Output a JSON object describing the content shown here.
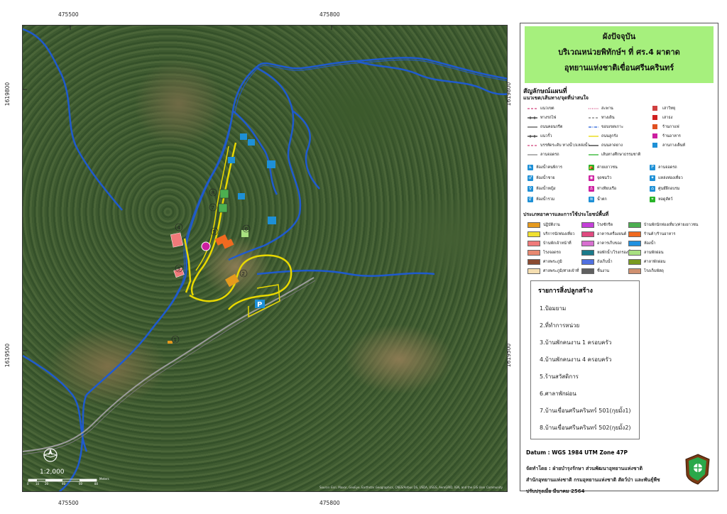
{
  "coords": {
    "top_x": [
      "475500",
      "475800"
    ],
    "bottom_x": [
      "475500",
      "475800"
    ],
    "left_y": [
      "1619800",
      "1619500"
    ],
    "right_y": [
      "1619800",
      "1619500"
    ]
  },
  "map": {
    "attribution": "Source: Esri, Maxar, GeoEye, Earthstar Geographics, CNES/Airbus DS, USDA, USGS, AeroGRID, IGN, and the GIS User Community",
    "scale_text": "1:2,000",
    "scale_unit": "Meters",
    "scale_ticks": [
      "0",
      "10",
      "20",
      "40",
      "60",
      "80"
    ],
    "labels": [
      "1",
      "2",
      "3",
      "4",
      "5",
      "6",
      "7",
      "8"
    ]
  },
  "title": {
    "line1": "ผังปัจจุบัน",
    "line2": "บริเวณหน่วยพิทักษ์ฯ ที่ ศร.4 ผาตาด",
    "line3": "อุทยานแห่งชาติเขื่อนศรีนครินทร์"
  },
  "legend": {
    "heading": "สัญลักษณ์แผนที่",
    "sub_lines": "แนวเขต/เส้นทาง/จุดที่น่าสนใจ",
    "lines": [
      {
        "label": "แนวเขต",
        "color": "#d0407a",
        "style": "dash"
      },
      {
        "label": "สะพาน",
        "color": "#d0407a",
        "style": "dot"
      },
      {
        "label": "เสาวิทยุ",
        "color": "#d04040",
        "style": "icon"
      },
      {
        "label": "ทางรถไฟ",
        "color": "#333",
        "style": "rail"
      },
      {
        "label": "ทางเดิน",
        "color": "#777",
        "style": "dash"
      },
      {
        "label": "เสาธง",
        "color": "#d02020",
        "style": "icon"
      },
      {
        "label": "ถนนคอนกรีต",
        "color": "#555",
        "style": "solid"
      },
      {
        "label": "ขอบเขตเกาะ",
        "color": "#1e5bd6",
        "style": "dashdot"
      },
      {
        "label": "ร้านกาแฟ",
        "color": "#e05020",
        "style": "icon"
      },
      {
        "label": "แนวรั้ว",
        "color": "#333",
        "style": "fence"
      },
      {
        "label": "ถนนลูกรัง",
        "color": "#e8d800",
        "style": "solid"
      },
      {
        "label": "ร้านอาหาร",
        "color": "#cc1fa0",
        "style": "icon"
      },
      {
        "label": "บรรทัดระดับ ทางน้ำ/แหล่งน้ำ",
        "color": "#d0407a",
        "style": "dash"
      },
      {
        "label": "ถนนลาดยาง",
        "color": "#333",
        "style": "solid"
      },
      {
        "label": "ลานกางเต็นท์",
        "color": "#1e90d6",
        "style": "icon"
      },
      {
        "label": "ลานจอดรถ",
        "color": "#888",
        "style": "solid"
      },
      {
        "label": "เส้นทางศึกษาธรรมชาติ",
        "color": "#28b428",
        "style": "solid"
      }
    ],
    "points": [
      {
        "label": "ห้องน้ำคนพิการ",
        "color": "#1e90d6",
        "glyph": "♿"
      },
      {
        "label": "ค่ายเยาวชน",
        "color": "#28b428",
        "glyph": "⛺"
      },
      {
        "label": "ลานจอดรถ",
        "color": "#1e90d6",
        "glyph": "P"
      },
      {
        "label": "ห้องน้ำชาย",
        "color": "#1e90d6",
        "glyph": "♂"
      },
      {
        "label": "จุดชมวิว",
        "color": "#cc1fa0",
        "glyph": "◉"
      },
      {
        "label": "แหล่งท่องเที่ยว",
        "color": "#1e90d6",
        "glyph": "✦"
      },
      {
        "label": "ห้องน้ำหญิง",
        "color": "#1e90d6",
        "glyph": "♀"
      },
      {
        "label": "ท่าเทียบเรือ",
        "color": "#cc1fa0",
        "glyph": "⚓"
      },
      {
        "label": "ศูนย์ฝึกอบรม",
        "color": "#1e90d6",
        "glyph": "⌂"
      },
      {
        "label": "ห้องน้ำรวม",
        "color": "#1e90d6",
        "glyph": "⚥"
      },
      {
        "label": "น้ำตก",
        "color": "#1e90d6",
        "glyph": "≋"
      },
      {
        "label": "หอดูสัตว์",
        "color": "#28b428",
        "glyph": "⌖"
      }
    ],
    "sub_buildings": "ประเภทอาคารและการใช้ประโยชน์พื้นที่",
    "buildings": [
      {
        "label": "ปฏิบัติงาน",
        "color": "#e59a1e"
      },
      {
        "label": "โรงซักรีด",
        "color": "#c43fd8"
      },
      {
        "label": "บ้านพักนักท่องเที่ยว/ค่ายเยาวชน",
        "color": "#4caf50"
      },
      {
        "label": "บริการนักท่องเที่ยว",
        "color": "#f0e030"
      },
      {
        "label": "อาคารเครื่องยนต์",
        "color": "#e04a80"
      },
      {
        "label": "ร้านค้า/ร้านอาหาร",
        "color": "#f06a20"
      },
      {
        "label": "บ้านพักเจ้าหน้าที่",
        "color": "#f07a7a"
      },
      {
        "label": "อาคารเก็บของ",
        "color": "#d870d0"
      },
      {
        "label": "ห้องน้ำ",
        "color": "#2090e0"
      },
      {
        "label": "โรงจอดรถ",
        "color": "#e88870"
      },
      {
        "label": "หอพักน้ำ/โรงกรองน้ำ",
        "color": "#1a7a8a"
      },
      {
        "label": "ลานพักผ่อน",
        "color": "#a8e080"
      },
      {
        "label": "ศาลพระภูมิ",
        "color": "#8a4a30"
      },
      {
        "label": "ถังเก็บน้ำ",
        "color": "#5070e0"
      },
      {
        "label": "ศาลาพักผ่อน",
        "color": "#7a9a20"
      },
      {
        "label": "ศาลพระภูมิ/ศาลเจ้าที่",
        "color": "#f5deb0"
      },
      {
        "label": "ชิ้นงาน",
        "color": "#606060"
      },
      {
        "label": "โรงเก็บพัสดุ",
        "color": "#d09070"
      }
    ]
  },
  "construction": {
    "heading": "รายการสิ่งปลูกสร้าง",
    "items": [
      "1.ป้อมยาม",
      "2.ที่ทำการหน่วย",
      "3.บ้านพักคนงาน 1 ครอบครัว",
      "4.บ้านพักคนงาน 4 ครอบครัว",
      "5.ร้านสวัสดิการ",
      "6.ศาลาพักผ่อน",
      "7.บ้านเขื่อนศรีนครินทร์ 501(กุยมั้ง1)",
      "8.บ้านเขื่อนศรีนครินทร์ 502(กุยมั้ง2)"
    ]
  },
  "datum": "Datum : WGS 1984 UTM Zone 47P",
  "credits": {
    "line1": "จัดทำโดย : ฝ่ายบำรุงรักษา ส่วนพัฒนาอุทยานแห่งชาติ",
    "line2": "สำนักอุทยานแห่งชาติ กรมอุทยานแห่งชาติ สัตว์ป่า และพันธุ์พืช",
    "line3": "ปรับปรุงเมื่อ มีนาคม 2564"
  }
}
